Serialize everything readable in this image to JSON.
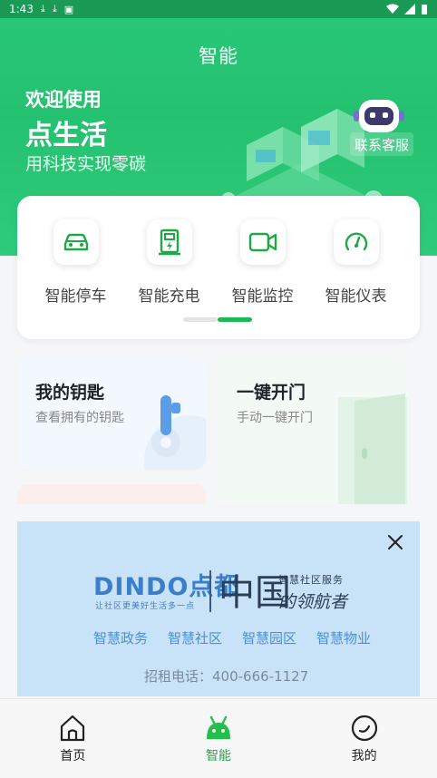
{
  "status_bar": {
    "time": "1:43"
  },
  "hero": {
    "title": "智能",
    "welcome": "欢迎使用",
    "brand": "点生活",
    "slogan": "用科技实现零碳",
    "service_button": "联系客服"
  },
  "features": [
    {
      "label": "智能停车",
      "icon": "car-icon"
    },
    {
      "label": "智能充电",
      "icon": "charging-station-icon"
    },
    {
      "label": "智能监控",
      "icon": "video-camera-icon"
    },
    {
      "label": "智能仪表",
      "icon": "gauge-icon"
    }
  ],
  "key_cards": {
    "my_keys": {
      "title": "我的钥匙",
      "subtitle": "查看拥有的钥匙"
    },
    "open_door": {
      "title": "一键开门",
      "subtitle": "手动一键开门"
    }
  },
  "ad": {
    "brand": "DINDO点都",
    "brand_sub": "让社区更美好生活多一点",
    "china": "中国",
    "tagline_top": "智慧社区服务",
    "tagline_bottom": "的领航者",
    "links": [
      "智慧政务",
      "智慧社区",
      "智慧园区",
      "智慧物业"
    ],
    "phone": "招租电话：400-666-1127"
  },
  "bottom_nav": [
    {
      "label": "首页",
      "icon": "home-icon"
    },
    {
      "label": "智能",
      "icon": "android-robot-icon",
      "active": true
    },
    {
      "label": "我的",
      "icon": "profile-smile-icon"
    }
  ],
  "colors": {
    "brand_green": "#24c170",
    "active_green": "#1fa846",
    "ad_blue": "#c8e2f7"
  }
}
